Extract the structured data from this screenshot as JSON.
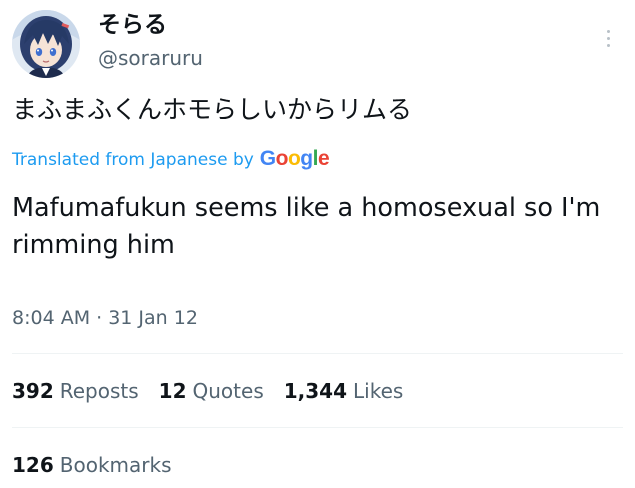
{
  "author": {
    "display_name": "そらる",
    "handle": "@soraruru"
  },
  "tweet": {
    "text": "まふまふくんホモらしいからリムる",
    "translation_label": "Translated from Japanese by",
    "translation_provider": "Google",
    "translated_text": "Mafumafukun seems like a homosexual so I'm rimming him",
    "timestamp": "8:04 AM · 31 Jan 12"
  },
  "stats": {
    "reposts_count": "392",
    "reposts_label": "Reposts",
    "quotes_count": "12",
    "quotes_label": "Quotes",
    "likes_count": "1,344",
    "likes_label": "Likes",
    "bookmarks_count": "126",
    "bookmarks_label": "Bookmarks"
  },
  "colors": {
    "link_blue": "#1d9bf0",
    "secondary_text": "#536471",
    "primary_text": "#0f1419",
    "divider": "#eff3f4"
  },
  "icons": {
    "more": "vertical-ellipsis-icon",
    "avatar": "user-avatar-image"
  }
}
